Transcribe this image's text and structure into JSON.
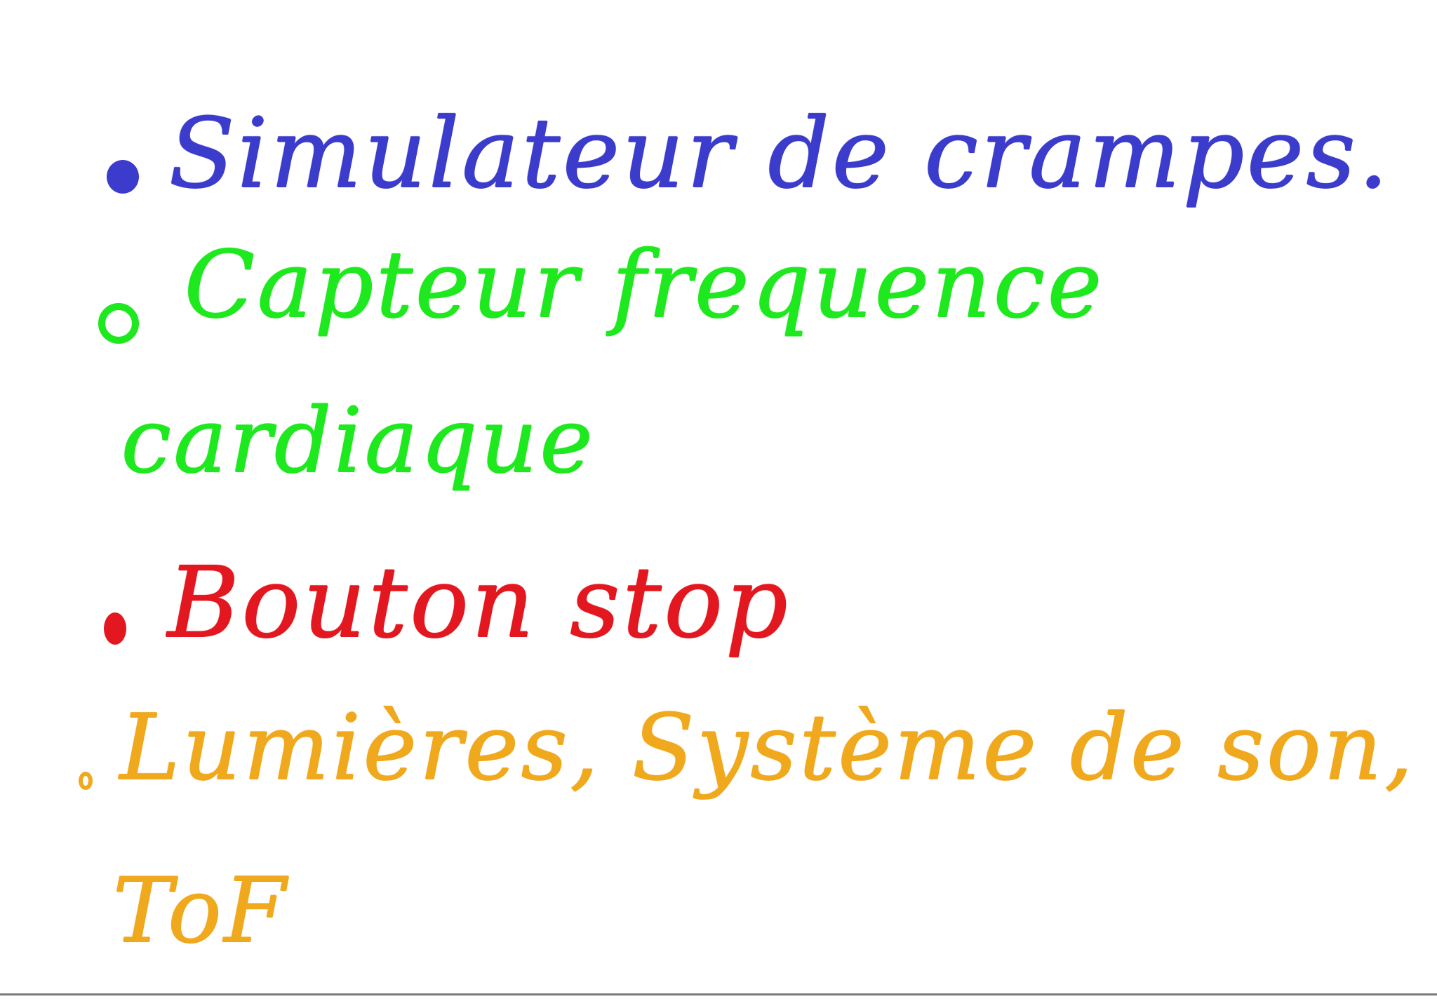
{
  "notes": {
    "items": [
      {
        "text": "Simulateur de crampes.",
        "color": "#3b3bcc"
      },
      {
        "text": "Capteur frequence",
        "text2": "cardiaque",
        "color": "#1ee81e"
      },
      {
        "text": "Bouton stop",
        "color": "#e3171f"
      },
      {
        "text": "Lumières, Système de son,",
        "text2": "ToF",
        "color": "#f0a81c"
      }
    ]
  }
}
